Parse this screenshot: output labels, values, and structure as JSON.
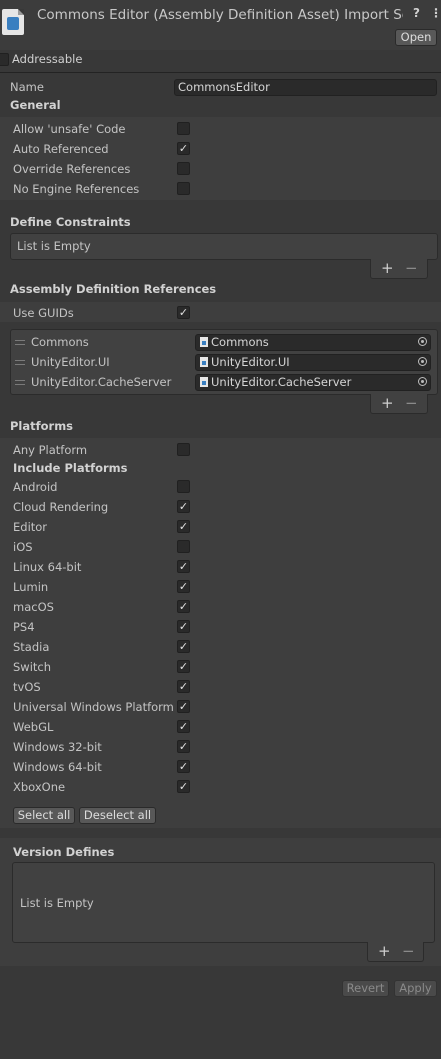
{
  "header": {
    "title": "Commons Editor (Assembly Definition Asset) Import Settin",
    "help_icon": "?",
    "menu_icon": "⋮",
    "open_label": "Open"
  },
  "addressable": {
    "label": "Addressable",
    "checked": false
  },
  "name": {
    "label": "Name",
    "value": "CommonsEditor"
  },
  "general": {
    "heading": "General",
    "options": [
      {
        "label": "Allow 'unsafe' Code",
        "checked": false
      },
      {
        "label": "Auto Referenced",
        "checked": true
      },
      {
        "label": "Override References",
        "checked": false
      },
      {
        "label": "No Engine References",
        "checked": false
      }
    ]
  },
  "define_constraints": {
    "heading": "Define Constraints",
    "empty_text": "List is Empty"
  },
  "assembly_refs": {
    "heading": "Assembly Definition References",
    "use_guids": {
      "label": "Use GUIDs",
      "checked": true
    },
    "items": [
      {
        "label": "Commons",
        "value": "Commons"
      },
      {
        "label": "UnityEditor.UI",
        "value": "UnityEditor.UI"
      },
      {
        "label": "UnityEditor.CacheServer",
        "value": "UnityEditor.CacheServer"
      }
    ]
  },
  "platforms": {
    "heading": "Platforms",
    "any_platform": {
      "label": "Any Platform",
      "checked": false
    },
    "include_heading": "Include Platforms",
    "items": [
      {
        "label": "Android",
        "checked": false
      },
      {
        "label": "Cloud Rendering",
        "checked": true
      },
      {
        "label": "Editor",
        "checked": true
      },
      {
        "label": "iOS",
        "checked": false
      },
      {
        "label": "Linux 64-bit",
        "checked": true
      },
      {
        "label": "Lumin",
        "checked": true
      },
      {
        "label": "macOS",
        "checked": true
      },
      {
        "label": "PS4",
        "checked": true
      },
      {
        "label": "Stadia",
        "checked": true
      },
      {
        "label": "Switch",
        "checked": true
      },
      {
        "label": "tvOS",
        "checked": true
      },
      {
        "label": "Universal Windows Platform",
        "checked": true
      },
      {
        "label": "WebGL",
        "checked": true
      },
      {
        "label": "Windows 32-bit",
        "checked": true
      },
      {
        "label": "Windows 64-bit",
        "checked": true
      },
      {
        "label": "XboxOne",
        "checked": true
      }
    ],
    "select_all": "Select all",
    "deselect_all": "Deselect all"
  },
  "version_defines": {
    "heading": "Version Defines",
    "empty_text": "List is Empty"
  },
  "list_controls": {
    "add": "+",
    "remove": "−"
  },
  "footer": {
    "revert": "Revert",
    "apply": "Apply"
  },
  "checkmark": "✓"
}
